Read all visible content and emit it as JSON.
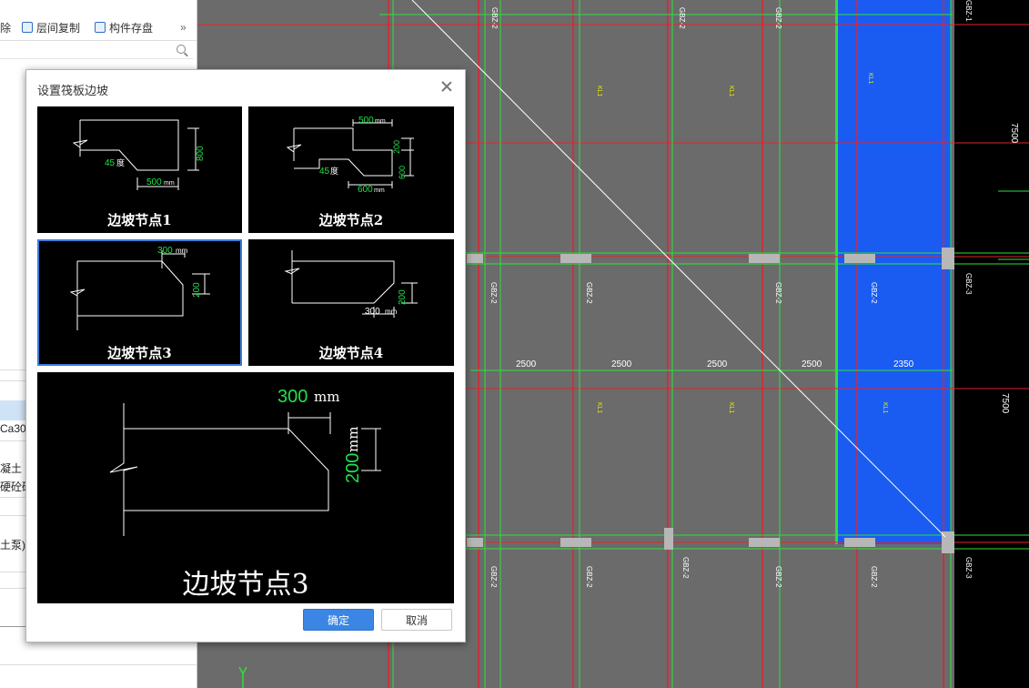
{
  "toolbar": {
    "delete_label": "除",
    "floor_copy_label": "层间复制",
    "component_save_label": "构件存盘",
    "more": "»"
  },
  "left_panel": {
    "prop_c30": "Ca30",
    "prop_concrete": "凝土",
    "prop_mortar": "硬砼砾",
    "prop_pump": "土泵)"
  },
  "dialog": {
    "title": "设置筏板边坡",
    "nodes": [
      {
        "label": "边坡节点1",
        "dims": {
          "angle": "45",
          "angle_unit": "度",
          "height": "800",
          "width": "500",
          "unit": "mm"
        }
      },
      {
        "label": "边坡节点2",
        "dims": {
          "top": "500",
          "h1": "200",
          "h2": "600",
          "angle": "45",
          "angle_unit": "度",
          "bottom": "600",
          "unit": "mm"
        }
      },
      {
        "label": "边坡节点3",
        "dims": {
          "width": "300",
          "height": "200",
          "unit": "mm"
        }
      },
      {
        "label": "边坡节点4",
        "dims": {
          "width": "300",
          "height": "200",
          "unit": "mm"
        }
      }
    ],
    "selected_index": 2,
    "preview": {
      "label": "边坡节点3",
      "width": "300",
      "height": "200",
      "unit": "mm"
    },
    "ok_label": "确定",
    "cancel_label": "取消"
  },
  "cad": {
    "dims": [
      "2500",
      "2500",
      "2500",
      "2500",
      "2350"
    ],
    "side_dims": [
      "7500",
      "7500"
    ],
    "beam_tags": [
      "GBZ-2",
      "GBZ-3",
      "GBZ-1",
      "KL1"
    ],
    "highlight_color": "#1a5cf2",
    "grid_red": "#e0242e",
    "grid_green": "#2fe03a"
  }
}
